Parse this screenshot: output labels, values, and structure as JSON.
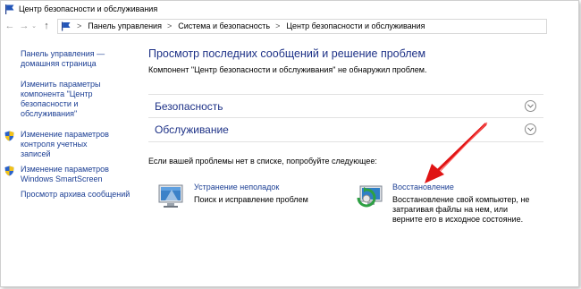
{
  "window": {
    "title": "Центр безопасности и обслуживания",
    "icon": "flag-icon"
  },
  "address": {
    "back_icon": "←",
    "forward_icon": "→",
    "history_icon": "⌄",
    "up_icon": "↑",
    "separator": ">",
    "crumbs": [
      "Панель управления",
      "Система и безопасность",
      "Центр безопасности и обслуживания"
    ]
  },
  "sidebar": {
    "items": [
      {
        "label": "Панель управления — домашняя страница",
        "shield": false
      },
      {
        "label": "Изменить параметры компонента \"Центр безопасности и обслуживания\"",
        "shield": false
      },
      {
        "label": "Изменение параметров контроля учетных записей",
        "shield": true
      },
      {
        "label": "Изменение параметров Windows SmartScreen",
        "shield": true
      },
      {
        "label": "Просмотр архива сообщений",
        "shield": false
      }
    ]
  },
  "main": {
    "title": "Просмотр последних сообщений и решение проблем",
    "note": "Компонент \"Центр безопасности и обслуживания\" не обнаружил проблем.",
    "sections": [
      {
        "label": "Безопасность",
        "icon": "chevron-down-icon"
      },
      {
        "label": "Обслуживание",
        "icon": "chevron-down-icon"
      }
    ],
    "suggest_text": "Если вашей проблемы нет в списке, попробуйте следующее:",
    "tools": [
      {
        "link": "Устранение неполадок",
        "desc": "Поиск и исправление проблем",
        "icon": "troubleshooting-icon"
      },
      {
        "link": "Восстановление",
        "desc": "Восстановление свой компьютер, не затрагивая файлы на нем, или верните его в исходное состояние.",
        "icon": "recovery-icon"
      }
    ]
  },
  "colors": {
    "link": "#1c3f94",
    "heading": "#1e3287",
    "annotation_arrow": "#e01414"
  }
}
